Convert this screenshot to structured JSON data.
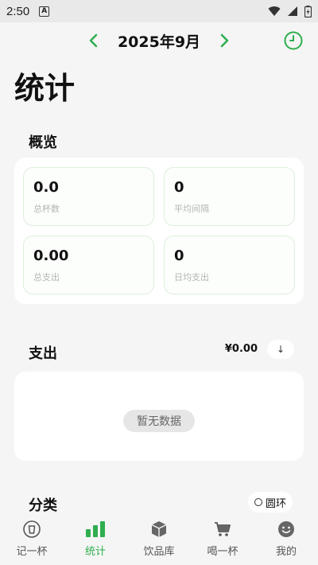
{
  "status_bar": {
    "time": "2:50",
    "notif_letter": "A"
  },
  "header": {
    "month_label": "2025年9月"
  },
  "page": {
    "title": "统计"
  },
  "overview": {
    "title": "概览",
    "stats": [
      {
        "value": "0.0",
        "label": "总杯数"
      },
      {
        "value": "0",
        "label": "平均间隔"
      },
      {
        "value": "0.00",
        "label": "总支出"
      },
      {
        "value": "0",
        "label": "日均支出"
      }
    ]
  },
  "expense": {
    "title": "支出",
    "amount": "¥0.00",
    "sort_symbol": "↓",
    "empty_text": "暂无数据"
  },
  "category": {
    "title": "分类",
    "toggle_label": "圆环"
  },
  "bottom_nav": [
    {
      "label": "记一杯",
      "icon": "cup-refresh-icon"
    },
    {
      "label": "统计",
      "icon": "bar-chart-icon"
    },
    {
      "label": "饮品库",
      "icon": "box-icon"
    },
    {
      "label": "喝一杯",
      "icon": "cart-icon"
    },
    {
      "label": "我的",
      "icon": "smiley-icon"
    }
  ],
  "colors": {
    "accent": "#2fae4f",
    "background": "#f5f5f5",
    "card": "#ffffff"
  }
}
